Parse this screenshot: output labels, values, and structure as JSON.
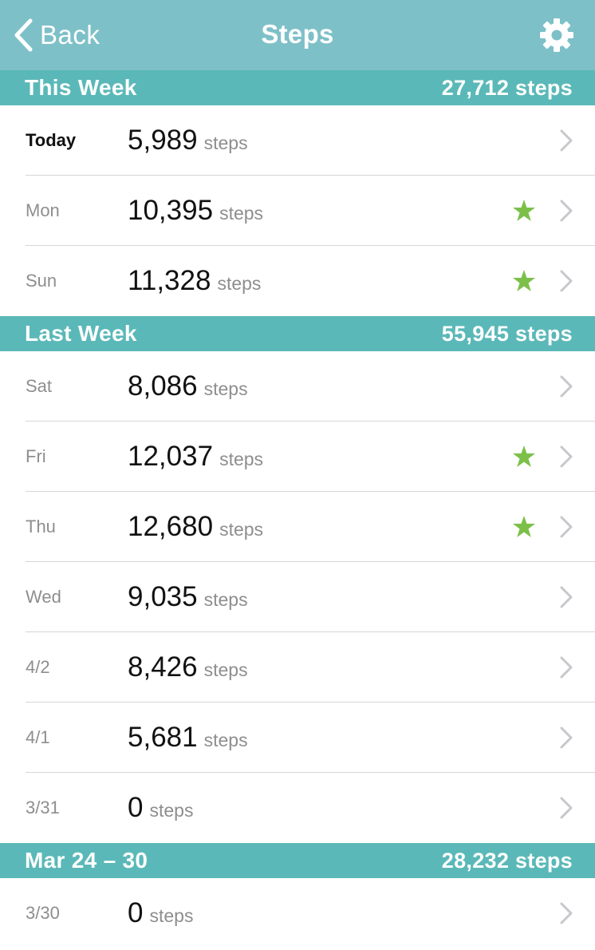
{
  "nav": {
    "back_label": "Back",
    "title": "Steps",
    "settings_icon": "gear-icon"
  },
  "sections": [
    {
      "title": "This Week",
      "total": "27,712 steps",
      "rows": [
        {
          "day": "Today",
          "count": "5,989",
          "unit": "steps",
          "goal_met": false,
          "today": true
        },
        {
          "day": "Mon",
          "count": "10,395",
          "unit": "steps",
          "goal_met": true
        },
        {
          "day": "Sun",
          "count": "11,328",
          "unit": "steps",
          "goal_met": true
        }
      ]
    },
    {
      "title": "Last Week",
      "total": "55,945 steps",
      "rows": [
        {
          "day": "Sat",
          "count": "8,086",
          "unit": "steps",
          "goal_met": false
        },
        {
          "day": "Fri",
          "count": "12,037",
          "unit": "steps",
          "goal_met": true
        },
        {
          "day": "Thu",
          "count": "12,680",
          "unit": "steps",
          "goal_met": true
        },
        {
          "day": "Wed",
          "count": "9,035",
          "unit": "steps",
          "goal_met": false
        },
        {
          "day": "4/2",
          "count": "8,426",
          "unit": "steps",
          "goal_met": false
        },
        {
          "day": "4/1",
          "count": "5,681",
          "unit": "steps",
          "goal_met": false
        },
        {
          "day": "3/31",
          "count": "0",
          "unit": "steps",
          "goal_met": false
        }
      ]
    },
    {
      "title": "Mar 24 – 30",
      "total": "28,232 steps",
      "rows": [
        {
          "day": "3/30",
          "count": "0",
          "unit": "steps",
          "goal_met": false
        }
      ]
    }
  ],
  "colors": {
    "nav_bg": "#7ec0c8",
    "section_bg": "#5bb8b8",
    "star": "#7cc04a",
    "chevron": "#c7c7cc"
  }
}
